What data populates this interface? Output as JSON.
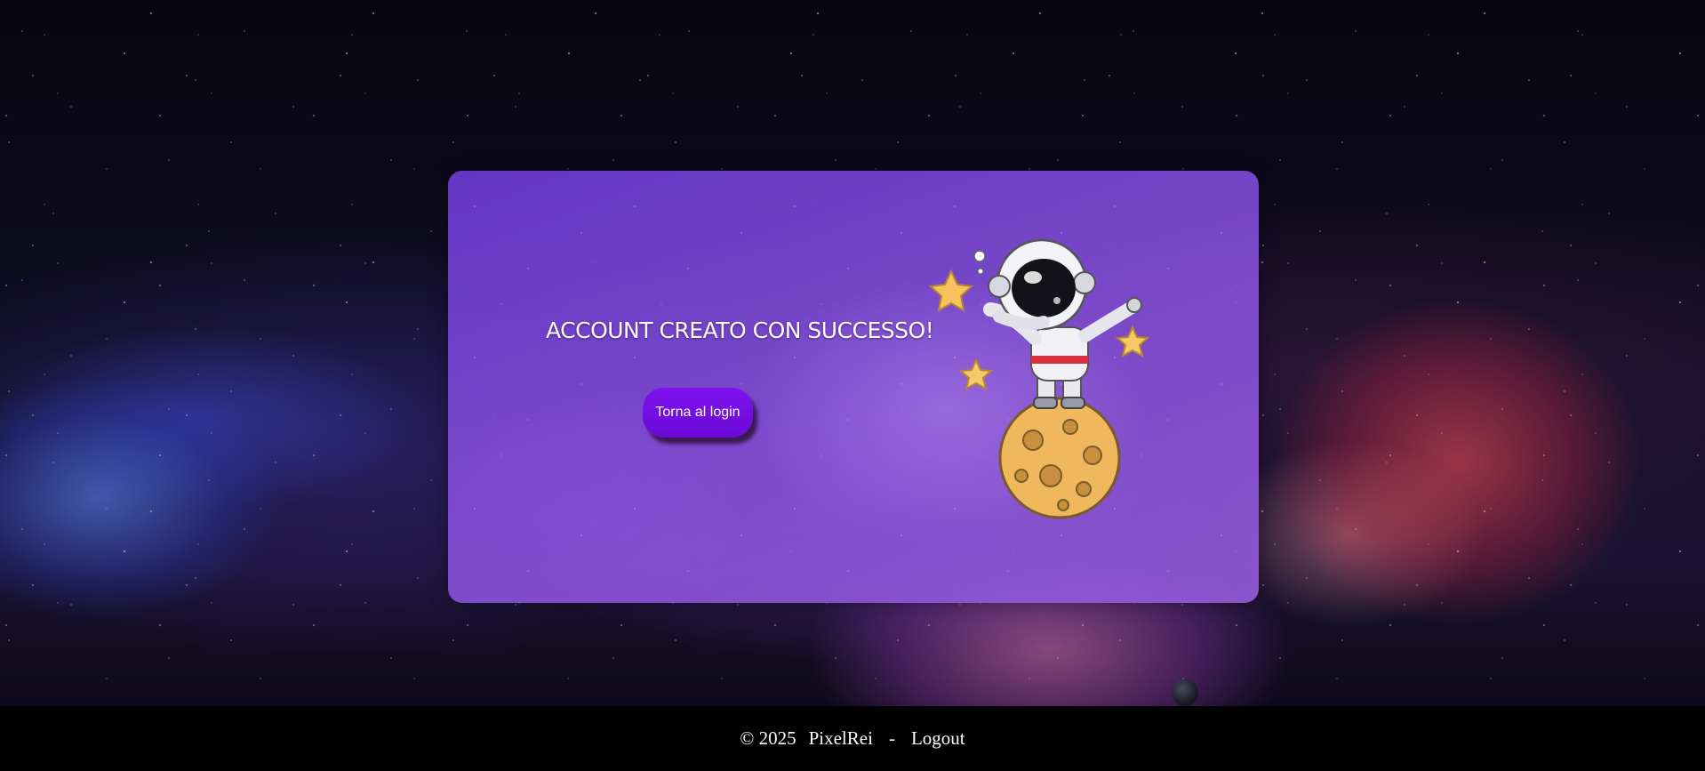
{
  "card": {
    "heading": "ACCOUNT CREATO CON SUCCESSO!",
    "back_to_login_label": "Torna al login"
  },
  "footer": {
    "copyright": "© 2025",
    "brand": "PixelRei",
    "separator": "-",
    "logout_label": "Logout"
  },
  "colors": {
    "card_purple": "#7a46d2",
    "button_purple": "#7a10e8",
    "footer_black": "#000000",
    "text_white": "#ffffff"
  },
  "icons": {
    "illustration": "astronaut-on-moon-illustration",
    "stars": "star-icon"
  }
}
